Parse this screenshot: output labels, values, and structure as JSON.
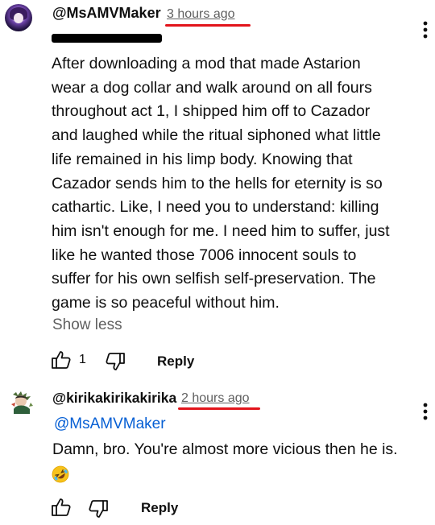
{
  "comment": {
    "handle": "@MsAMVMaker",
    "time": "3 hours ago",
    "body": "After downloading a mod that made Astarion\nwear a dog collar and walk around on all fours\nthroughout act 1, I shipped him off to Cazador\nand laughed while the ritual siphoned what little\nlife remained in his limp body. Knowing that\nCazador sends him to the hells for eternity is so\ncathartic. Like, I need you to understand: killing\nhim isn't enough for me. I need him to suffer, just\nlike he wanted those 7006 innocent souls to\nsuffer for his own selfish self-preservation. The\ngame is so peaceful without him.",
    "show_less": "Show less",
    "like_count": "1",
    "reply_label": "Reply",
    "menu_icon": "more-vert-icon"
  },
  "reply": {
    "handle": "@kirikakirikakirika",
    "time": "2 hours ago",
    "mention": "@MsAMVMaker",
    "body": "Damn, bro. You're almost more vicious then he is.",
    "emoji": "rolling-on-floor-laughing-emoji",
    "reply_label": "Reply",
    "menu_icon": "more-vert-icon"
  },
  "colors": {
    "annotation_underline": "#e2141b",
    "mention_link": "#065fd4",
    "secondary_text": "#606060"
  }
}
